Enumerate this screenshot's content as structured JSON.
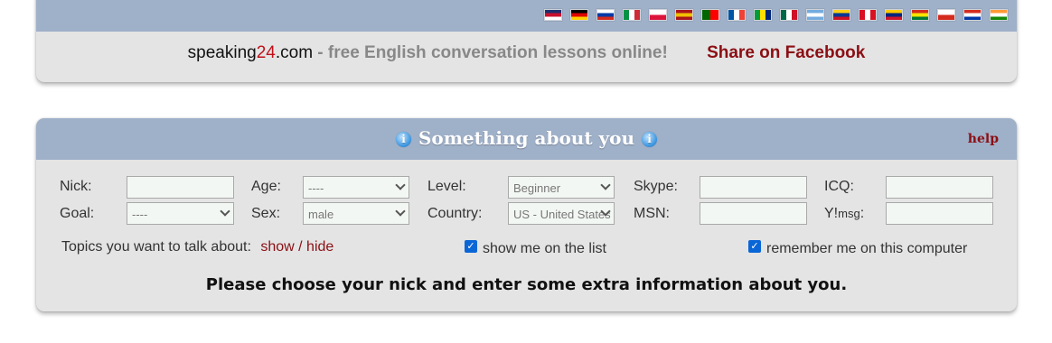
{
  "flags": [
    {
      "name": "uk-flag",
      "colors": [
        "#1d2f6e",
        "#c8102e",
        "#ffffff"
      ]
    },
    {
      "name": "germany-flag",
      "colors": [
        "#000000",
        "#dd0000",
        "#ffce00"
      ]
    },
    {
      "name": "russia-flag",
      "colors": [
        "#ffffff",
        "#0039a6",
        "#d52b1e"
      ]
    },
    {
      "name": "italy-flag",
      "colors": [
        "#009246",
        "#ffffff",
        "#ce2b37"
      ]
    },
    {
      "name": "poland-flag",
      "colors": [
        "#ffffff",
        "#dc143c"
      ]
    },
    {
      "name": "spain-flag",
      "colors": [
        "#aa151b",
        "#f1bf00",
        "#aa151b"
      ]
    },
    {
      "name": "portugal-flag",
      "colors": [
        "#006600",
        "#ff0000"
      ]
    },
    {
      "name": "france-flag",
      "colors": [
        "#0055a4",
        "#ffffff",
        "#ef4135"
      ]
    },
    {
      "name": "brazil-flag",
      "colors": [
        "#009b3a",
        "#fedf00",
        "#002776"
      ]
    },
    {
      "name": "mexico-flag",
      "colors": [
        "#006847",
        "#ffffff",
        "#ce1126"
      ]
    },
    {
      "name": "argentina-flag",
      "colors": [
        "#74acdf",
        "#ffffff",
        "#74acdf"
      ]
    },
    {
      "name": "colombia-flag",
      "colors": [
        "#fcd116",
        "#003893",
        "#ce1126"
      ]
    },
    {
      "name": "peru-flag",
      "colors": [
        "#d91023",
        "#ffffff",
        "#d91023"
      ]
    },
    {
      "name": "venezuela-flag",
      "colors": [
        "#ffcc00",
        "#00247d",
        "#cf142b"
      ]
    },
    {
      "name": "bolivia-flag",
      "colors": [
        "#d52b1e",
        "#f9e300",
        "#007934"
      ]
    },
    {
      "name": "chile-flag",
      "colors": [
        "#ffffff",
        "#d52b1e"
      ]
    },
    {
      "name": "paraguay-flag",
      "colors": [
        "#d52b1e",
        "#ffffff",
        "#0038a8"
      ]
    },
    {
      "name": "india-flag",
      "colors": [
        "#ff9933",
        "#ffffff",
        "#138808"
      ]
    }
  ],
  "header": {
    "site_name": "speaking",
    "site_num": "24",
    "site_tld": ".com",
    "description": " - free English conversation lessons online!",
    "facebook_link": "Share on Facebook"
  },
  "form": {
    "title": "Something about you",
    "help_link": "help",
    "nick_label": "Nick:",
    "nick_value": "",
    "goal_label": "Goal:",
    "goal_selected": "----",
    "age_label": "Age:",
    "age_selected": "----",
    "sex_label": "Sex:",
    "sex_selected": "male",
    "level_label": "Level:",
    "level_selected": "Beginner",
    "country_label": "Country:",
    "country_selected": "US - United States",
    "skype_label": "Skype:",
    "skype_value": "",
    "msn_label": "MSN:",
    "msn_value": "",
    "icq_label": "ICQ:",
    "icq_value": "",
    "ymsg_label": "Y!",
    "ymsg_small": "msg",
    "ymsg_colon": ":",
    "ymsg_value": "",
    "topics_label": "Topics you want to talk about:",
    "topics_toggle": "show / hide",
    "show_on_list_label": "show me on the list",
    "show_on_list_checked": true,
    "remember_me_label": "remember me on this computer",
    "remember_me_checked": true,
    "bottom_message": "Please choose your nick and enter some extra information about you."
  },
  "colors": {
    "header_bar": "#9fb0c9",
    "panel_bg": "#e4e4e4",
    "brand_red": "#c0101a",
    "link_dark_red": "#8b0f14",
    "checkbox_blue": "#0a66d6"
  }
}
